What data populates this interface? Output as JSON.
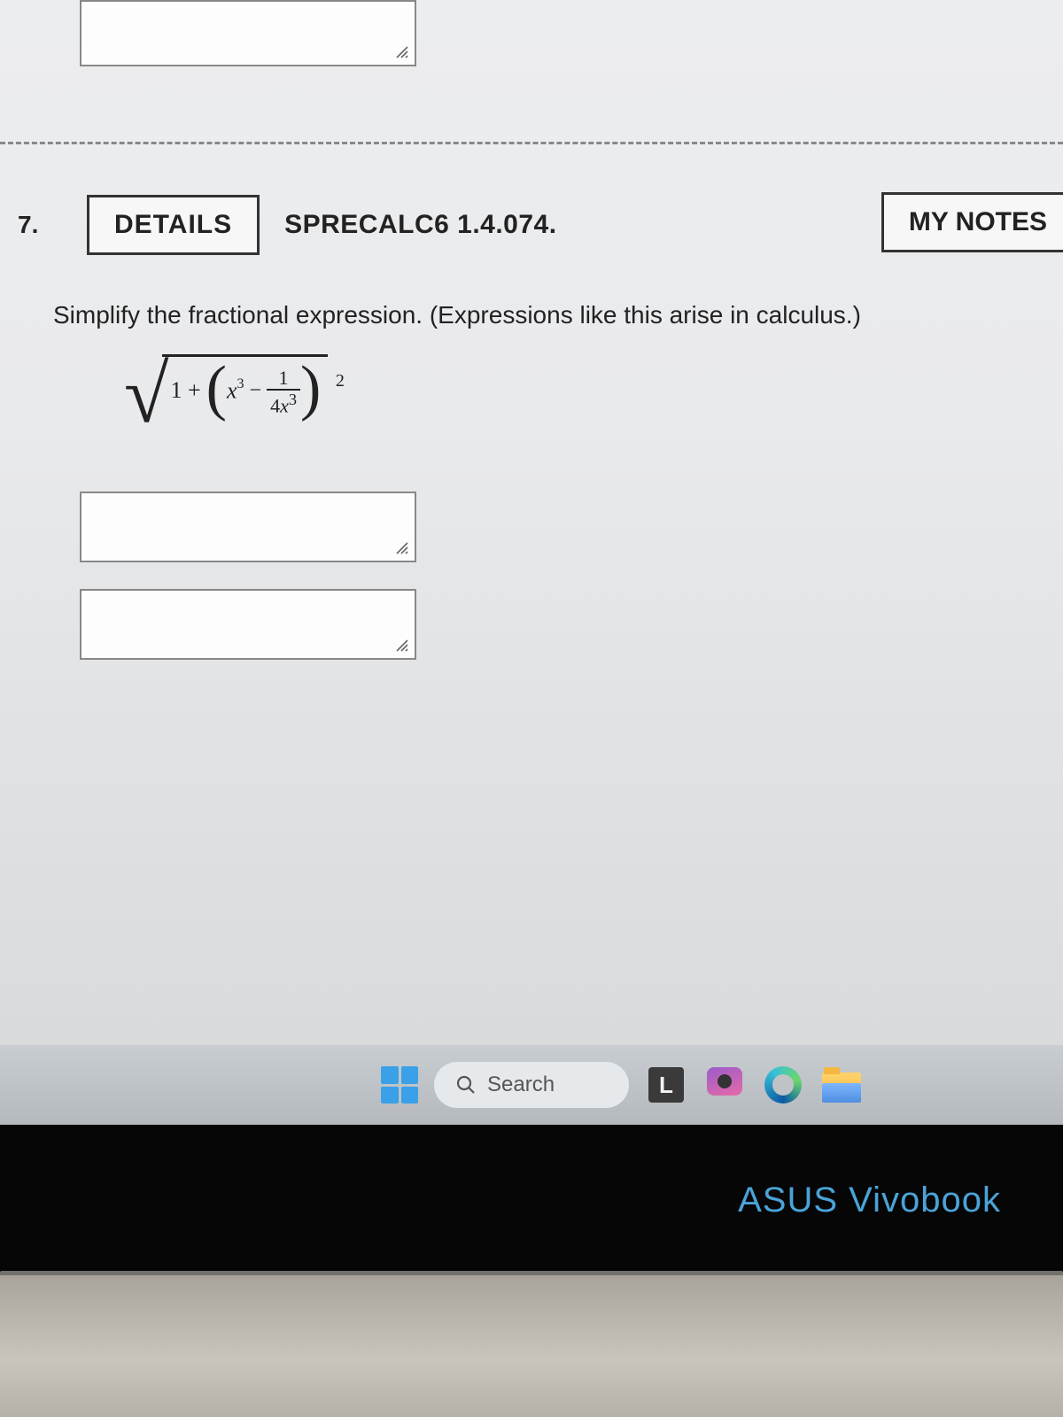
{
  "question": {
    "number": "7.",
    "details_label": "DETAILS",
    "reference": "SPRECALC6 1.4.074.",
    "mynotes_label": "MY NOTES",
    "prompt": "Simplify the fractional expression. (Expressions like this arise in calculus.)",
    "math": {
      "one_plus": "1 +",
      "x_base": "x",
      "x_exp": "3",
      "minus": "−",
      "frac_num": "1",
      "frac_den_coef": "4",
      "frac_den_x": "x",
      "frac_den_exp": "3",
      "outer_exp": "2"
    }
  },
  "taskbar": {
    "search_label": "Search"
  },
  "bezel": {
    "brand": "ASUS Vivobook"
  }
}
